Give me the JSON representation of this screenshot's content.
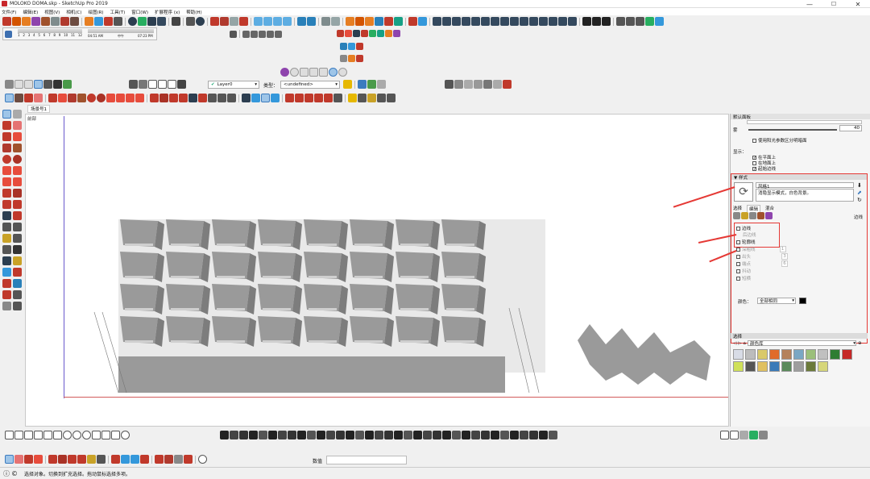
{
  "window": {
    "title": "MOLOKO DOMA.skp - SketchUp Pro 2019",
    "minimize": "—",
    "maximize": "☐",
    "close": "✕"
  },
  "menu": [
    "文件(F)",
    "编辑(E)",
    "视图(V)",
    "相机(C)",
    "绘图(R)",
    "工具(T)",
    "窗口(W)",
    "扩展程序 (x)",
    "帮助(H)"
  ],
  "shadow_bar": {
    "months": [
      "1",
      "2",
      "3",
      "4",
      "5",
      "6",
      "7",
      "8",
      "9",
      "10",
      "11",
      "12"
    ],
    "time_start": "04:51 AM",
    "time_mid": "中午",
    "time_end": "07:23 PM"
  },
  "layer_bar": {
    "layer_value": "Layer0",
    "type_label": "类型：",
    "type_value": "<undefined>"
  },
  "scene_tab": "场景号1",
  "canvas_label": "前部",
  "panel": {
    "default_tray": "默认面板",
    "fog_label": "雾",
    "fog_value": "40",
    "use_bg_color": "使用阳光参数区分明暗面",
    "display": "显示：",
    "opt1": "在平面上",
    "opt2": "在地面上",
    "opt3": "起始边线",
    "styles": "▼ 样式",
    "style_name": "风格1",
    "style_desc": "消隐显示模式，白色背景。",
    "tabs": [
      "选择",
      "编辑",
      "混合"
    ],
    "edges_label": "边线",
    "edge_cb1": "边线",
    "edge_cb1_sub": "后边线",
    "edge_cb2": "轮廓线",
    "edge_cb3": "深粗线",
    "edge_cb3_val": "1",
    "edge_cb4": "出头",
    "edge_cb4_val": "3",
    "edge_cb5": "端点",
    "edge_cb5_val": "6",
    "edge_cb6": "抖动",
    "edge_cb7": "短横",
    "color_label": "颜色：",
    "color_value": "全部相同",
    "materials": "选择",
    "material_lib": "颜色库"
  },
  "status": {
    "text": "选择对象。切换到扩充选择。拖动鼠标选择多项。",
    "value_label": "数值"
  },
  "colors": {
    "accent_red": "#e53935",
    "building_gray": "#9a9a9a",
    "canvas_bg": "#ffffff"
  }
}
